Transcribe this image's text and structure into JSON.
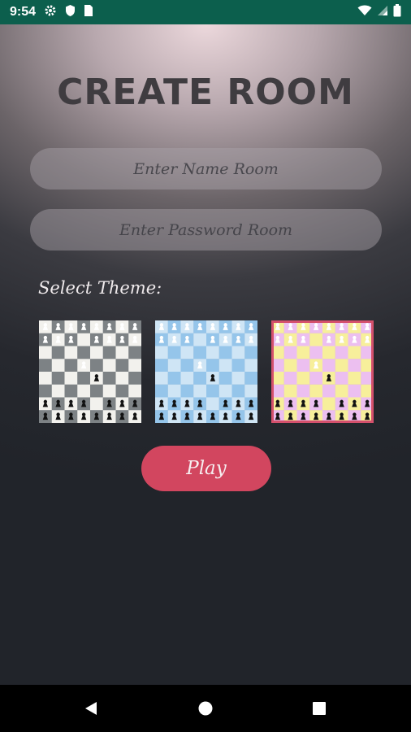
{
  "status_bar": {
    "time": "9:54",
    "left_icons": [
      "settings-icon",
      "shield-icon",
      "sim-card-icon"
    ],
    "right_icons": [
      "wifi-icon",
      "cell-signal-icon",
      "battery-icon"
    ],
    "background": "#0c5f4d"
  },
  "page": {
    "title": "CREATE ROOM"
  },
  "form": {
    "name_placeholder": "Enter Name Room",
    "name_value": "",
    "password_placeholder": "Enter Password Room",
    "password_value": ""
  },
  "themes": {
    "label": "Select Theme:",
    "items": [
      {
        "name": "gray",
        "light": "#f2f1ed",
        "dark": "#7d8285",
        "selected": false
      },
      {
        "name": "blue",
        "light": "#cfe5f5",
        "dark": "#95c5ea",
        "selected": false
      },
      {
        "name": "pink",
        "light": "#f7ef9b",
        "dark": "#ecbff0",
        "selected": true,
        "border": "#d4506c"
      }
    ]
  },
  "actions": {
    "play_label": "Play",
    "play_color": "#d2465f"
  },
  "nav_bar": {
    "icons": [
      "back-icon",
      "home-icon",
      "recents-icon"
    ]
  }
}
